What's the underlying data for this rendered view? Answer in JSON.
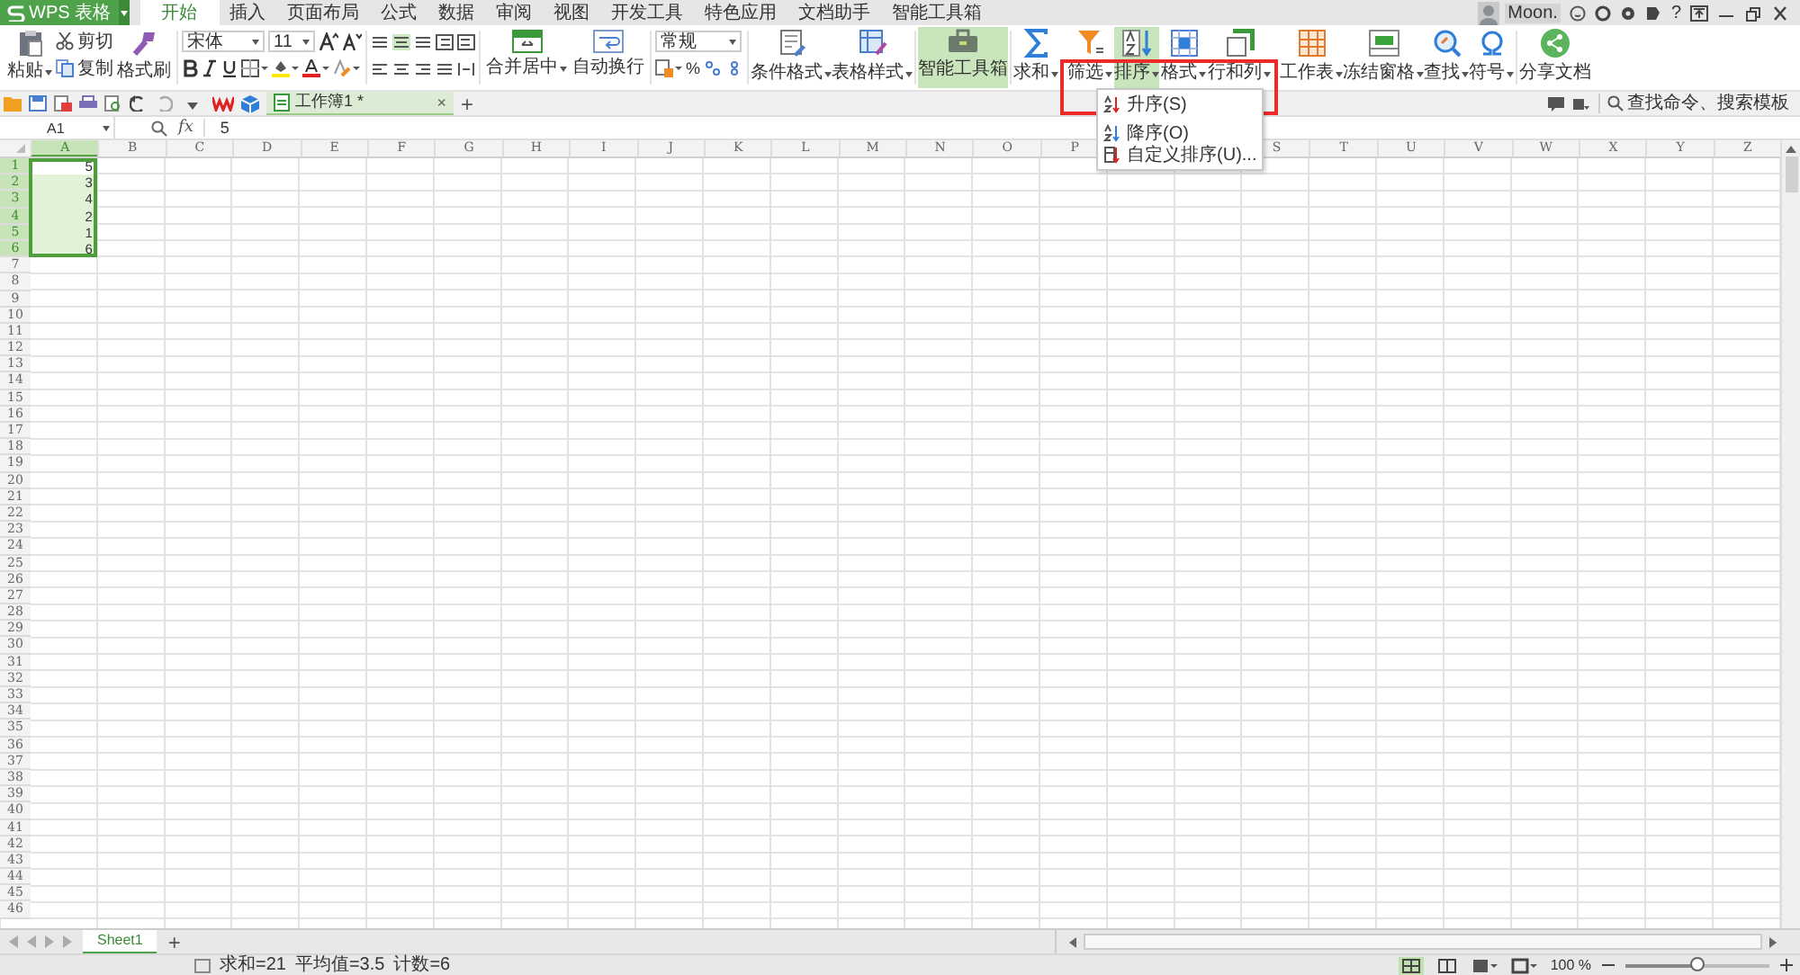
{
  "title_bar": {
    "app_button": "WPS 表格",
    "tabs": [
      {
        "label": "开始",
        "selected": true
      },
      {
        "label": "插入",
        "selected": false
      },
      {
        "label": "页面布局",
        "selected": false
      },
      {
        "label": "公式",
        "selected": false
      },
      {
        "label": "数据",
        "selected": false
      },
      {
        "label": "审阅",
        "selected": false
      },
      {
        "label": "视图",
        "selected": false
      },
      {
        "label": "开发工具",
        "selected": false
      },
      {
        "label": "特色应用",
        "selected": false
      },
      {
        "label": "文档助手",
        "selected": false
      },
      {
        "label": "智能工具箱",
        "selected": false
      }
    ],
    "user": "Moon.",
    "help": "?"
  },
  "ribbon": {
    "paste": "粘贴",
    "cut": "剪切",
    "copy": "复制",
    "format_painter": "格式刷",
    "font_name": "宋体",
    "font_size": "11",
    "merge": "合并居中",
    "wrap": "自动换行",
    "number_format": "常规",
    "percent": "%",
    "tools": [
      {
        "label": "条件格式",
        "dropdown": true,
        "pressed": false
      },
      {
        "label": "表格样式",
        "dropdown": true,
        "pressed": false
      },
      {
        "label": "智能工具箱",
        "dropdown": false,
        "pressed": true
      },
      {
        "label": "求和",
        "dropdown": true,
        "pressed": false
      },
      {
        "label": "筛选",
        "dropdown": true,
        "pressed": false
      },
      {
        "label": "排序",
        "dropdown": true,
        "pressed": true
      },
      {
        "label": "格式",
        "dropdown": true,
        "pressed": false
      },
      {
        "label": "行和列",
        "dropdown": true,
        "pressed": false
      },
      {
        "label": "工作表",
        "dropdown": true,
        "pressed": false
      },
      {
        "label": "冻结窗格",
        "dropdown": true,
        "pressed": false
      },
      {
        "label": "查找",
        "dropdown": true,
        "pressed": false
      },
      {
        "label": "符号",
        "dropdown": true,
        "pressed": false
      },
      {
        "label": "分享文档",
        "dropdown": false,
        "pressed": false
      }
    ],
    "search_placeholder": "查找命令、搜索模板"
  },
  "sort_menu": {
    "highlight_box": true,
    "items": [
      {
        "label": "升序(S)"
      },
      {
        "label": "降序(O)"
      },
      {
        "label": "自定义排序(U)..."
      }
    ]
  },
  "document_tab": {
    "title": "工作簿1 *",
    "close": "×",
    "new": "+"
  },
  "formula_bar": {
    "name_box": "A1",
    "fx": "fx",
    "value": "5"
  },
  "sheet": {
    "columns": [
      {
        "label": "A",
        "selected": true
      },
      {
        "label": "B",
        "selected": false
      },
      {
        "label": "C",
        "selected": false
      },
      {
        "label": "D",
        "selected": false
      },
      {
        "label": "E",
        "selected": false
      },
      {
        "label": "F",
        "selected": false
      },
      {
        "label": "G",
        "selected": false
      },
      {
        "label": "H",
        "selected": false
      },
      {
        "label": "I",
        "selected": false
      },
      {
        "label": "J",
        "selected": false
      },
      {
        "label": "K",
        "selected": false
      },
      {
        "label": "L",
        "selected": false
      },
      {
        "label": "M",
        "selected": false
      },
      {
        "label": "N",
        "selected": false
      },
      {
        "label": "O",
        "selected": false
      },
      {
        "label": "P",
        "selected": false
      },
      {
        "selected": false
      },
      {
        "selected": false
      },
      {
        "label": "S",
        "selected": false
      },
      {
        "label": "T",
        "selected": false
      },
      {
        "label": "U",
        "selected": false
      },
      {
        "label": "V",
        "selected": false
      },
      {
        "label": "W",
        "selected": false
      },
      {
        "label": "X",
        "selected": false
      },
      {
        "label": "Y",
        "selected": false
      },
      {
        "label": "Z",
        "selected": false
      }
    ],
    "rows": [
      {
        "label": "1",
        "selected": true,
        "cells": [
          {
            "value": "5",
            "active": true
          }
        ]
      },
      {
        "label": "2",
        "selected": true,
        "cells": [
          {
            "value": "3",
            "active": false
          }
        ]
      },
      {
        "label": "3",
        "selected": true,
        "cells": [
          {
            "value": "4",
            "active": false
          }
        ]
      },
      {
        "label": "4",
        "selected": true,
        "cells": [
          {
            "value": "2",
            "active": false
          }
        ]
      },
      {
        "label": "5",
        "selected": true,
        "cells": [
          {
            "value": "1",
            "active": false
          }
        ]
      },
      {
        "label": "6",
        "selected": true,
        "cells": [
          {
            "value": "6",
            "active": false
          }
        ]
      },
      {
        "label": "7",
        "selected": false
      },
      {
        "label": "8",
        "selected": false
      },
      {
        "label": "9",
        "selected": false
      },
      {
        "label": "10",
        "selected": false
      },
      {
        "label": "11",
        "selected": false
      },
      {
        "label": "12",
        "selected": false
      },
      {
        "label": "13",
        "selected": false
      },
      {
        "label": "14",
        "selected": false
      },
      {
        "label": "15",
        "selected": false
      },
      {
        "label": "16",
        "selected": false
      },
      {
        "label": "17",
        "selected": false
      },
      {
        "label": "18",
        "selected": false
      },
      {
        "label": "19",
        "selected": false
      },
      {
        "label": "20",
        "selected": false
      },
      {
        "label": "21",
        "selected": false
      },
      {
        "label": "22",
        "selected": false
      },
      {
        "label": "23",
        "selected": false
      },
      {
        "label": "24",
        "selected": false
      },
      {
        "label": "25",
        "selected": false
      },
      {
        "label": "26",
        "selected": false
      },
      {
        "label": "27",
        "selected": false
      },
      {
        "label": "28",
        "selected": false
      },
      {
        "label": "29",
        "selected": false
      },
      {
        "label": "30",
        "selected": false
      },
      {
        "label": "31",
        "selected": false
      },
      {
        "label": "32",
        "selected": false
      },
      {
        "label": "33",
        "selected": false
      },
      {
        "label": "34",
        "selected": false
      },
      {
        "label": "35",
        "selected": false
      },
      {
        "label": "36",
        "selected": false
      },
      {
        "label": "37",
        "selected": false
      },
      {
        "label": "38",
        "selected": false
      },
      {
        "label": "39",
        "selected": false
      },
      {
        "label": "40",
        "selected": false
      },
      {
        "label": "41",
        "selected": false
      },
      {
        "label": "42",
        "selected": false
      },
      {
        "label": "43",
        "selected": false
      },
      {
        "label": "44",
        "selected": false
      },
      {
        "label": "45",
        "selected": false
      },
      {
        "label": "46",
        "selected": false
      }
    ]
  },
  "sheet_tabs": [
    {
      "label": "Sheet1",
      "selected": true
    }
  ],
  "add_sheet": "+",
  "status_bar": {
    "statistics": [
      "求和=21",
      "平均值=3.5",
      "计数=6"
    ],
    "zoom": "100 %",
    "zoom_slider": {
      "level": 0.5
    }
  }
}
